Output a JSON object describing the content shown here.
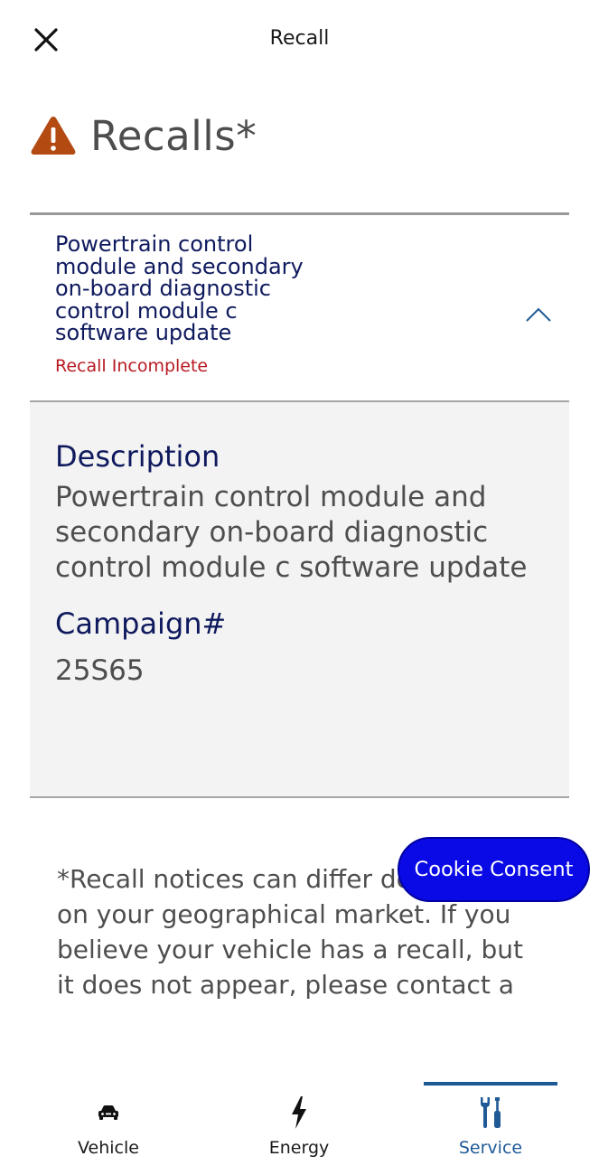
{
  "header": {
    "title": "Recall",
    "close_icon": "close-icon"
  },
  "page": {
    "heading": "Recalls*",
    "heading_icon": "warning-triangle-icon",
    "accent_color": "#b34a12"
  },
  "recall": {
    "title": "Powertrain control module and secondary on-board diagnostic control module c software update",
    "status": "Recall Incomplete",
    "status_color": "#b81a22",
    "expanded": true,
    "description_label": "Description",
    "description": "Powertrain control module and secondary on-board diagnostic control module c software update",
    "campaign_label": "Campaign#",
    "campaign": "25S65"
  },
  "footnote": "*Recall notices can differ depending on your geographical market. If you believe your vehicle has a recall, but it does not appear, please contact a",
  "cookie": {
    "label": "Cookie Consent",
    "color": "#0a0ae6"
  },
  "nav": {
    "items": [
      {
        "label": "Vehicle",
        "icon": "car-icon"
      },
      {
        "label": "Energy",
        "icon": "lightning-icon"
      },
      {
        "label": "Service",
        "icon": "wrench-screwdriver-icon"
      }
    ],
    "active": "Service",
    "active_color": "#1f5a96"
  }
}
